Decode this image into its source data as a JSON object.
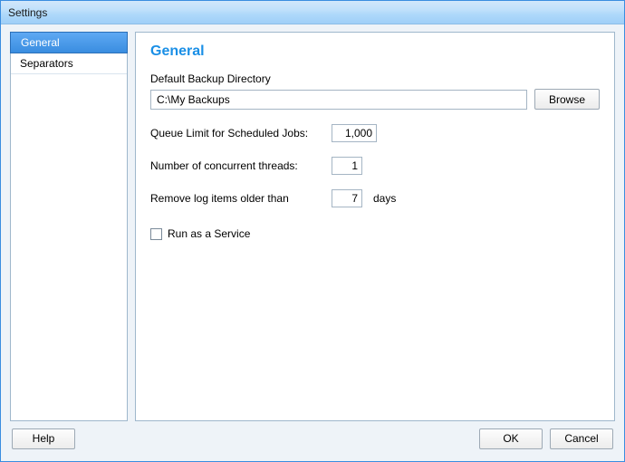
{
  "window": {
    "title": "Settings"
  },
  "nav": {
    "items": [
      {
        "label": "General",
        "selected": true
      },
      {
        "label": "Separators",
        "selected": false
      }
    ]
  },
  "main": {
    "section_title": "General",
    "backup_dir": {
      "label": "Default Backup Directory",
      "value": "C:\\My Backups",
      "browse_label": "Browse"
    },
    "queue_limit": {
      "label": "Queue Limit for Scheduled Jobs:",
      "value": "1,000"
    },
    "threads": {
      "label": "Number of concurrent threads:",
      "value": "1"
    },
    "log_retention": {
      "label": "Remove log items older than",
      "value": "7",
      "suffix": "days"
    },
    "run_service": {
      "label": "Run as a Service",
      "checked": false
    }
  },
  "footer": {
    "help": "Help",
    "ok": "OK",
    "cancel": "Cancel"
  }
}
